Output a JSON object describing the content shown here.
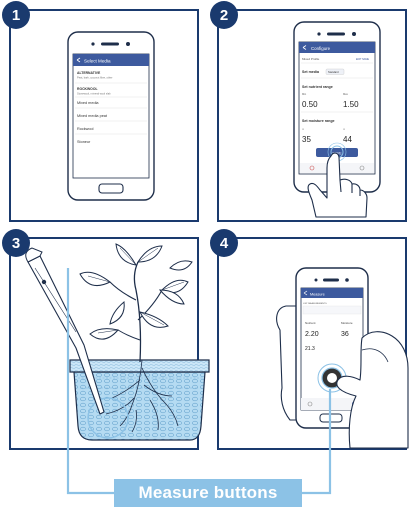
{
  "panels": [
    {
      "number": "1"
    },
    {
      "number": "2"
    },
    {
      "number": "3"
    },
    {
      "number": "4"
    }
  ],
  "phone1": {
    "title": "Select Media",
    "items": [
      {
        "label": "ALTERNATIVE",
        "sub": "Peat, bark, coconut fibre, other"
      },
      {
        "label": "ROCKWOOL",
        "sub": "Stonewool, mineral wool slab"
      },
      {
        "label": "Mixed media"
      },
      {
        "label": "Mixed media peat"
      },
      {
        "label": "Rockwool"
      },
      {
        "label": "Stoneur"
      }
    ]
  },
  "phone2": {
    "title": "Configure",
    "subtitle": "Mixed Profile",
    "subtitle_right": "EDIT NAME",
    "media_label": "Set media",
    "media_value": "Standard",
    "nutrient_label": "Set nutrient range",
    "nutrient_min_label": "Min",
    "nutrient_max_label": "Max",
    "nutrient_min": "0.50",
    "nutrient_max": "1.50",
    "moisture_label": "Set moisture range",
    "moisture_min": "35",
    "moisture_max": "44",
    "save_label": "SAVE"
  },
  "phone4": {
    "title": "Measure",
    "section": "LIST MEASUREMENTS",
    "nutrient_label": "Nutrient",
    "moisture_label": "Moisture",
    "nutrient_value": "2.20",
    "moisture_value": "36",
    "temp_value": "21.3"
  },
  "callout": {
    "label": "Measure buttons"
  },
  "colors": {
    "navy": "#1a3a6e",
    "callout": "#8cc2e6",
    "app_bar": "#3d5a9e",
    "water": "#a9d4ef"
  }
}
